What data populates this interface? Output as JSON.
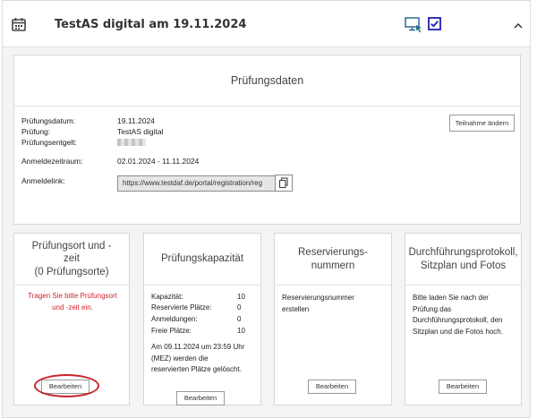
{
  "header": {
    "title": "TestAS digital am 19.11.2024",
    "icons": [
      "calendar-icon",
      "monitor-cursor-icon",
      "checkbox-checked-icon",
      "chevron-up-icon"
    ],
    "accent_color": "#1f1fb0"
  },
  "exam_data": {
    "title": "Prüfungsdaten",
    "change_button": "Teilnahme ändern",
    "fields": {
      "date_label": "Prüfungsdatum:",
      "date_value": "19.11.2024",
      "exam_label": "Prüfung:",
      "exam_value": "TestAS digital",
      "fee_label": "Prüfungsentgelt:",
      "registration_period_label": "Anmeldezeitraum:",
      "registration_period_value": "02.01.2024 - 11.11.2024",
      "registration_link_label": "Anmeldelink:",
      "registration_link_value": "https://www.testdaf.de/portal/registration/reg"
    }
  },
  "cards": {
    "location": {
      "title_line1": "Prüfungsort und -",
      "title_line2": "zeit",
      "title_line3": "(0 Prüfungsorte)",
      "warning_line1": "Tragen Sie bitte Prüfungsort",
      "warning_line2": "und -zeit ein.",
      "button": "Bearbeiten",
      "warning_color": "#d0242b"
    },
    "capacity": {
      "title": "Prüfungskapazität",
      "rows": [
        {
          "label": "Kapazität:",
          "value": "10"
        },
        {
          "label": "Reservierte Plätze:",
          "value": "0"
        },
        {
          "label": "Anmeldungen:",
          "value": "0"
        },
        {
          "label": "Freie Plätze:",
          "value": "10"
        }
      ],
      "note_line1": "Am 09.11.2024 um 23:59 Uhr",
      "note_line2": "(MEZ) werden die",
      "note_line3": "reservierten Plätze gelöscht.",
      "button": "Bearbeiten"
    },
    "reservation": {
      "title_line1": "Reservierungs-",
      "title_line2": "nummern",
      "text_line1": "Reservierungsnummer",
      "text_line2": "erstellen",
      "button": "Bearbeiten"
    },
    "protocol": {
      "title_line1": "Durchführungsprotokoll,",
      "title_line2": "Sitzplan und Fotos",
      "text_line1": "Bitte laden Sie nach der",
      "text_line2": "Prüfung das",
      "text_line3": "Durchführungsprotokoll, den",
      "text_line4": "Sitzplan und die Fotos hoch.",
      "button": "Bearbeiten"
    }
  }
}
